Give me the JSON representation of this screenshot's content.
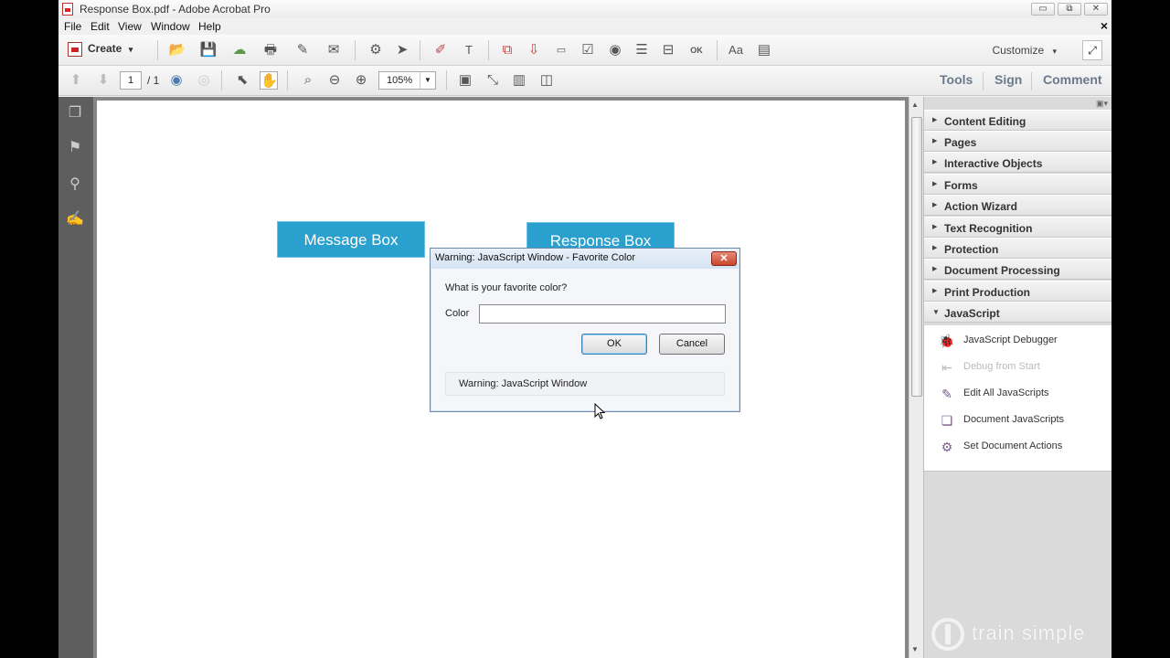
{
  "window": {
    "title": "Response Box.pdf - Adobe Acrobat Pro",
    "minimize": "▭",
    "restore": "⧉",
    "close": "✕"
  },
  "menu": {
    "items": [
      "File",
      "Edit",
      "View",
      "Window",
      "Help"
    ],
    "close_glyph": "×"
  },
  "toolbar": {
    "create_label": "Create",
    "customize_label": "Customize",
    "customize_arrow": "▾",
    "create_arrow": "▾",
    "expand_glyph": "⤢",
    "font_glyph": "Aa",
    "ok_glyph": "OK"
  },
  "nav": {
    "page_current": "1",
    "page_total": "/ 1",
    "zoom": "105%",
    "zoom_arrow": "▼"
  },
  "panel_tabs": [
    "Tools",
    "Sign",
    "Comment"
  ],
  "pdf_page": {
    "buttons": [
      "Message Box",
      "Response Box"
    ]
  },
  "right_panel": {
    "options_glyph": "▣▾",
    "sections": [
      "Content Editing",
      "Pages",
      "Interactive Objects",
      "Forms",
      "Action Wizard",
      "Text Recognition",
      "Protection",
      "Document Processing",
      "Print Production",
      "JavaScript"
    ],
    "javascript_items": [
      {
        "label": "JavaScript Debugger",
        "enabled": true
      },
      {
        "label": "Debug from Start",
        "enabled": false
      },
      {
        "label": "Edit All JavaScripts",
        "enabled": true
      },
      {
        "label": "Document JavaScripts",
        "enabled": true
      },
      {
        "label": "Set Document Actions",
        "enabled": true
      }
    ],
    "watermark": "train simple"
  },
  "dialog": {
    "title": "Warning: JavaScript Window - Favorite Color",
    "close_glyph": "✕",
    "question": "What is your favorite color?",
    "field_label": "Color",
    "field_value": "",
    "ok_label": "OK",
    "cancel_label": "Cancel",
    "warning_text": "Warning: JavaScript Window"
  },
  "colors": {
    "pdf_button": "#2aa0cf",
    "left_nav": "#5e5e5e",
    "doc_background": "#868686"
  }
}
